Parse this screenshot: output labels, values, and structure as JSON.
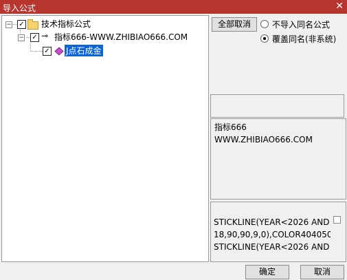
{
  "window": {
    "title": "导入公式",
    "close_glyph": "✕"
  },
  "tree": {
    "root": {
      "label": "技术指标公式",
      "checked": true,
      "expander": "−"
    },
    "group": {
      "label": "指标666-WWW.ZHIBIAO666.COM",
      "checked": true,
      "expander": "−",
      "icon_glyph": "⊸"
    },
    "item": {
      "label": "J点石成金",
      "checked": true,
      "selected": true
    }
  },
  "controls": {
    "cancel_all_label": "全部取消",
    "radio_no_import_label": "不导入同名公式",
    "radio_overwrite_label": "覆盖同名(非系统)",
    "selected_option": "overwrite"
  },
  "description": {
    "line1": "指标666",
    "line2": "WWW.ZHIBIAO666.COM"
  },
  "code": {
    "line1": "STICKLINE(YEAR<2026 AND",
    "line2": "18,90,90,9,0),COLOR404050;",
    "line3": "STICKLINE(YEAR<2026 AND"
  },
  "footer": {
    "ok_label": "确定",
    "cancel_label": "取消"
  },
  "colors": {
    "titlebar": "#b6352f",
    "selection": "#0a64d8"
  }
}
